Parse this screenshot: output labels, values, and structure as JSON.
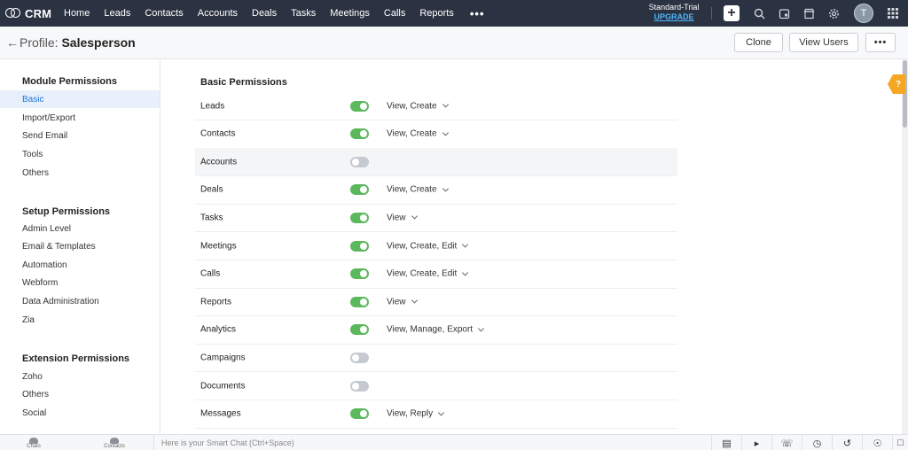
{
  "app": {
    "name": "CRM"
  },
  "nav": {
    "items": [
      "Home",
      "Leads",
      "Contacts",
      "Accounts",
      "Deals",
      "Tasks",
      "Meetings",
      "Calls",
      "Reports"
    ],
    "more": "•••"
  },
  "trial": {
    "plan": "Standard-Trial",
    "upgrade": "UPGRADE"
  },
  "top_icons": [
    "add-icon",
    "search-icon",
    "calendar-icon",
    "marketplace-icon",
    "gear-icon"
  ],
  "user": {
    "initial": "T"
  },
  "header": {
    "title_prefix": "Profile:",
    "title_name": "Salesperson",
    "clone": "Clone",
    "view_users": "View Users",
    "more": "•••"
  },
  "sidebar": {
    "groups": [
      {
        "title": "Module Permissions",
        "items": [
          "Basic",
          "Import/Export",
          "Send Email",
          "Tools",
          "Others"
        ],
        "active": 0
      },
      {
        "title": "Setup Permissions",
        "items": [
          "Admin Level",
          "Email & Templates",
          "Automation",
          "Webform",
          "Data Administration",
          "Zia"
        ]
      },
      {
        "title": "Extension Permissions",
        "items": [
          "Zoho",
          "Others",
          "Social"
        ]
      }
    ]
  },
  "main": {
    "title": "Basic Permissions",
    "permissions": [
      {
        "name": "Leads",
        "enabled": true,
        "value": "View, Create"
      },
      {
        "name": "Contacts",
        "enabled": true,
        "value": "View, Create"
      },
      {
        "name": "Accounts",
        "enabled": false,
        "value": ""
      },
      {
        "name": "Deals",
        "enabled": true,
        "value": "View, Create"
      },
      {
        "name": "Tasks",
        "enabled": true,
        "value": "View"
      },
      {
        "name": "Meetings",
        "enabled": true,
        "value": "View, Create, Edit"
      },
      {
        "name": "Calls",
        "enabled": true,
        "value": "View, Create, Edit"
      },
      {
        "name": "Reports",
        "enabled": true,
        "value": "View"
      },
      {
        "name": "Analytics",
        "enabled": true,
        "value": "View, Manage, Export"
      },
      {
        "name": "Campaigns",
        "enabled": false,
        "value": ""
      },
      {
        "name": "Documents",
        "enabled": false,
        "value": ""
      },
      {
        "name": "Messages",
        "enabled": true,
        "value": "View, Reply"
      }
    ]
  },
  "help": {
    "label": "?"
  },
  "bottom": {
    "chats": "Chats",
    "contacts": "Contacts",
    "smart_chat_placeholder": "Here is your Smart Chat (Ctrl+Space)"
  },
  "colors": {
    "topbar": "#2b3241",
    "toggle_on": "#5cb85c",
    "accent": "#1d74d6",
    "upgrade": "#4fb8ff",
    "help": "#f5a623"
  }
}
